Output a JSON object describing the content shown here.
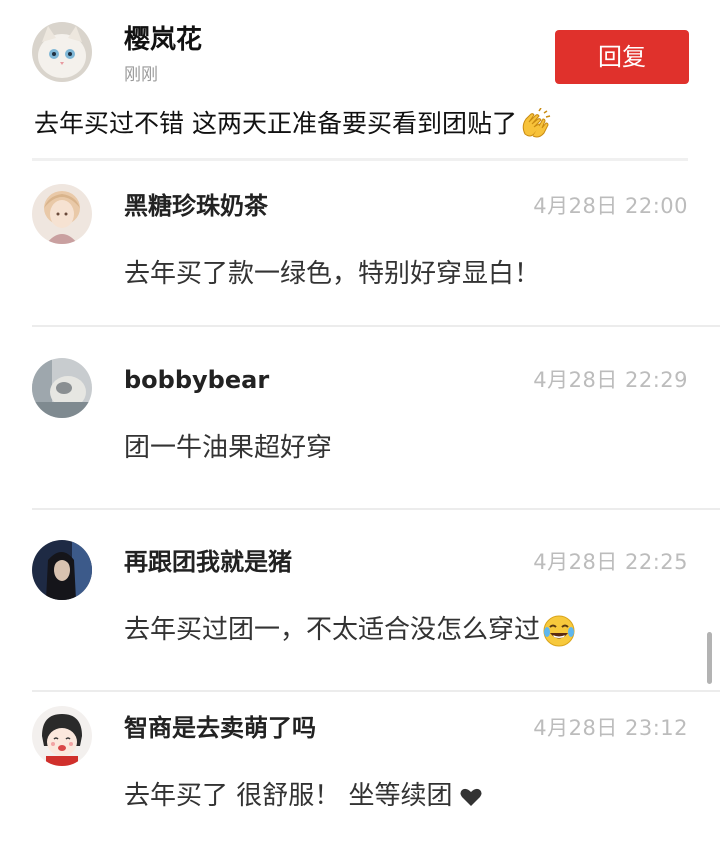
{
  "main_comment": {
    "author": "樱岚花",
    "time": "刚刚",
    "reply_label": "回复",
    "content": "去年买过不错 这两天正准备要买看到团贴了",
    "emoji": "clapping-hands-icon"
  },
  "replies": [
    {
      "author": "黑糖珍珠奶茶",
      "time": "4月28日 22:00",
      "text": "去年买了款一绿色，特别好穿显白！"
    },
    {
      "author": "bobbybear",
      "time": "4月28日 22:29",
      "text": "团一牛油果超好穿"
    },
    {
      "author": "再跟团我就是猪",
      "time": "4月28日 22:25",
      "text": "去年买过团一，不太适合没怎么穿过",
      "emoji": "tears-of-joy-icon"
    },
    {
      "author": "智商是去卖萌了吗",
      "time": "4月28日 23:12",
      "text": "去年买了 很舒服！ 坐等续团",
      "emoji": "heart-icon"
    }
  ],
  "colors": {
    "accent": "#e0312c",
    "time_text": "#bcbcbc",
    "divider": "#ececec"
  }
}
